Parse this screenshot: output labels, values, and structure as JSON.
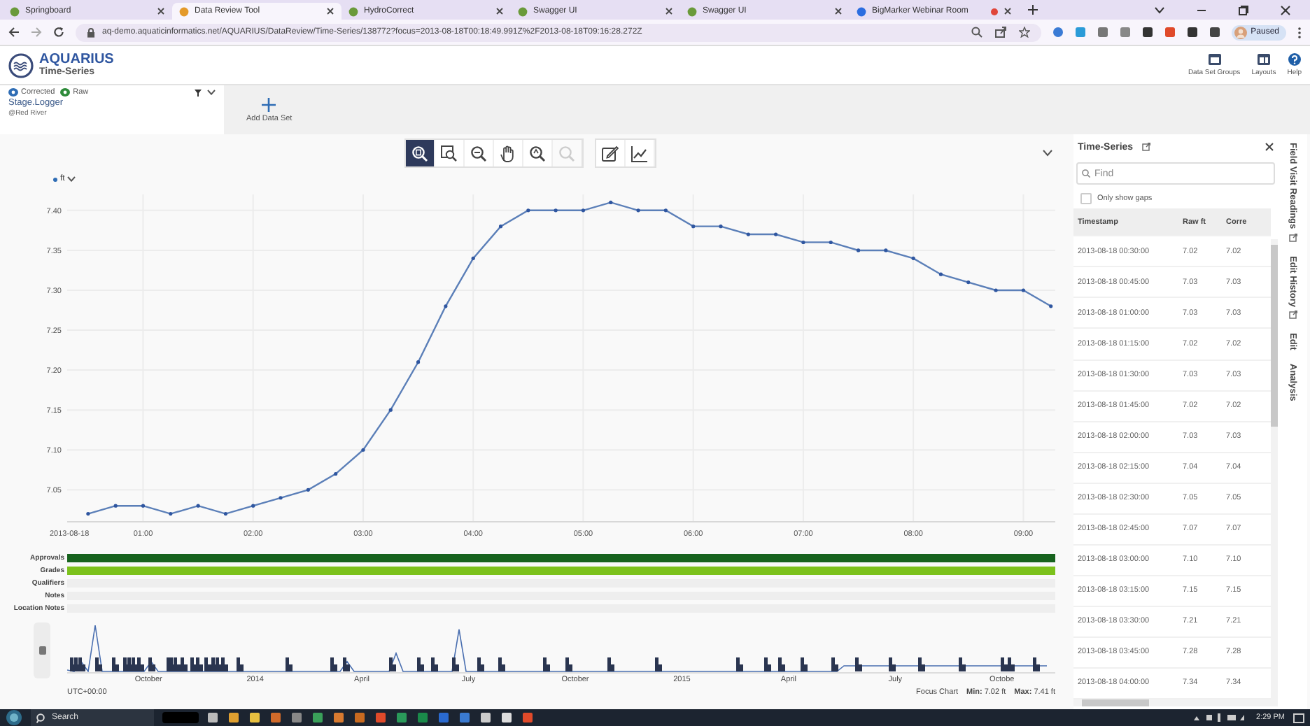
{
  "browser": {
    "tabs": [
      {
        "title": "Springboard",
        "selected": false,
        "recording": false
      },
      {
        "title": "Data Review Tool",
        "selected": true,
        "recording": false
      },
      {
        "title": "HydroCorrect",
        "selected": false,
        "recording": false
      },
      {
        "title": "Swagger UI",
        "selected": false,
        "recording": false
      },
      {
        "title": "Swagger UI",
        "selected": false,
        "recording": false
      },
      {
        "title": "BigMarker Webinar Room",
        "selected": false,
        "recording": true
      }
    ],
    "url": "aq-demo.aquaticinformatics.net/AQUARIUS/DataReview/Time-Series/138772?focus=2013-08-18T00:18:49.991Z%2F2013-08-18T09:16:28.272Z",
    "profile": "Paused"
  },
  "app": {
    "logo_title": "AQUARIUS",
    "logo_subtitle": "Time-Series",
    "header_actions": [
      {
        "kind": "groups",
        "label": "Data Set Groups"
      },
      {
        "kind": "layouts",
        "label": "Layouts"
      },
      {
        "kind": "help",
        "label": "Help"
      }
    ]
  },
  "data_set": {
    "legend": [
      {
        "label": "Corrected",
        "color": "#2f6db5"
      },
      {
        "label": "Raw",
        "color": "#2e8b3a"
      }
    ],
    "name": "Stage.Logger",
    "location": "@Red River"
  },
  "add_data_set": "Add Data Set",
  "chart_tools": [
    {
      "kind": "zoom",
      "selected": true,
      "disabled": false
    },
    {
      "kind": "zoom-box",
      "selected": false,
      "disabled": false
    },
    {
      "kind": "zoom-out",
      "selected": false,
      "disabled": false
    },
    {
      "kind": "pan",
      "selected": false,
      "disabled": false
    },
    {
      "kind": "zoom-back",
      "selected": false,
      "disabled": false
    },
    {
      "kind": "zoom-reset",
      "selected": false,
      "disabled": true
    }
  ],
  "edit_tools": [
    {
      "kind": "edit"
    },
    {
      "kind": "trend"
    }
  ],
  "chart": {
    "unit": "ft",
    "chart_data": {
      "type": "line",
      "grid": true,
      "xlim": [
        0.31,
        9.29
      ],
      "ylim": [
        7.01,
        7.42
      ],
      "xticks": [
        {
          "value": 0.33,
          "label": "2013-08-18"
        },
        {
          "value": 1,
          "label": "01:00"
        },
        {
          "value": 2,
          "label": "02:00"
        },
        {
          "value": 3,
          "label": "03:00"
        },
        {
          "value": 4,
          "label": "04:00"
        },
        {
          "value": 5,
          "label": "05:00"
        },
        {
          "value": 6,
          "label": "06:00"
        },
        {
          "value": 7,
          "label": "07:00"
        },
        {
          "value": 8,
          "label": "08:00"
        },
        {
          "value": 9,
          "label": "09:00"
        }
      ],
      "yticks": [
        {
          "value": 7.05,
          "label": "7.05"
        },
        {
          "value": 7.1,
          "label": "7.10"
        },
        {
          "value": 7.15,
          "label": "7.15"
        },
        {
          "value": 7.2,
          "label": "7.20"
        },
        {
          "value": 7.25,
          "label": "7.25"
        },
        {
          "value": 7.3,
          "label": "7.30"
        },
        {
          "value": 7.35,
          "label": "7.35"
        },
        {
          "value": 7.4,
          "label": "7.40"
        }
      ],
      "x": [
        0.5,
        0.75,
        1,
        1.25,
        1.5,
        1.75,
        2,
        2.25,
        2.5,
        2.75,
        3,
        3.25,
        3.5,
        3.75,
        4,
        4.25,
        4.5,
        4.75,
        5,
        5.25,
        5.5,
        5.75,
        6,
        6.25,
        6.5,
        6.75,
        7,
        7.25,
        7.5,
        7.75,
        8,
        8.25,
        8.5,
        8.75,
        9,
        9.25
      ],
      "series": [
        {
          "color": "#5b7fb8",
          "values": [
            7.02,
            7.03,
            7.03,
            7.02,
            7.03,
            7.02,
            7.03,
            7.04,
            7.05,
            7.07,
            7.1,
            7.15,
            7.21,
            7.28,
            7.34,
            7.38,
            7.4,
            7.4,
            7.4,
            7.41,
            7.4,
            7.4,
            7.38,
            7.38,
            7.37,
            7.37,
            7.36,
            7.36,
            7.35,
            7.35,
            7.34,
            7.32,
            7.31,
            7.3,
            7.3,
            7.28
          ]
        }
      ]
    }
  },
  "strips": [
    {
      "label": "Approvals",
      "color": "#17631e"
    },
    {
      "label": "Grades",
      "color": "#7cc21c"
    },
    {
      "label": "Qualifiers",
      "color": "#eeeeee"
    },
    {
      "label": "Notes",
      "color": "#eeeeee"
    },
    {
      "label": "Location Notes",
      "color": "#eeeeee"
    }
  ],
  "navigator": {
    "labels": [
      "October",
      "2014",
      "April",
      "July",
      "October",
      "2015",
      "April",
      "July",
      "Octobe"
    ]
  },
  "footer": {
    "timezone": "UTC+00:00",
    "focus": "Focus Chart",
    "min": "**Min:** 7.02 ft",
    "max": "**Max:** 7.41 ft"
  },
  "side_panel": {
    "title": "Time-Series",
    "search": {
      "placeholder": "Find"
    },
    "only_show_gaps": {
      "label": "Only show gaps",
      "checked": false
    },
    "columns": [
      "Timestamp",
      "Raw ft",
      "Corre"
    ],
    "rows": [
      [
        "2013-08-18 00:30:00",
        "7.02",
        "7.02"
      ],
      [
        "2013-08-18 00:45:00",
        "7.03",
        "7.03"
      ],
      [
        "2013-08-18 01:00:00",
        "7.03",
        "7.03"
      ],
      [
        "2013-08-18 01:15:00",
        "7.02",
        "7.02"
      ],
      [
        "2013-08-18 01:30:00",
        "7.03",
        "7.03"
      ],
      [
        "2013-08-18 01:45:00",
        "7.02",
        "7.02"
      ],
      [
        "2013-08-18 02:00:00",
        "7.03",
        "7.03"
      ],
      [
        "2013-08-18 02:15:00",
        "7.04",
        "7.04"
      ],
      [
        "2013-08-18 02:30:00",
        "7.05",
        "7.05"
      ],
      [
        "2013-08-18 02:45:00",
        "7.07",
        "7.07"
      ],
      [
        "2013-08-18 03:00:00",
        "7.10",
        "7.10"
      ],
      [
        "2013-08-18 03:15:00",
        "7.15",
        "7.15"
      ],
      [
        "2013-08-18 03:30:00",
        "7.21",
        "7.21"
      ],
      [
        "2013-08-18 03:45:00",
        "7.28",
        "7.28"
      ],
      [
        "2013-08-18 04:00:00",
        "7.34",
        "7.34"
      ]
    ]
  },
  "side_tabs": [
    {
      "label": "Field Visit Readings",
      "external": true
    },
    {
      "label": "Edit History",
      "external": true
    },
    {
      "label": "Edit",
      "external": false
    },
    {
      "label": "Analysis",
      "external": false
    }
  ],
  "taskbar": {
    "search": "Search",
    "time": "2:29 PM"
  }
}
